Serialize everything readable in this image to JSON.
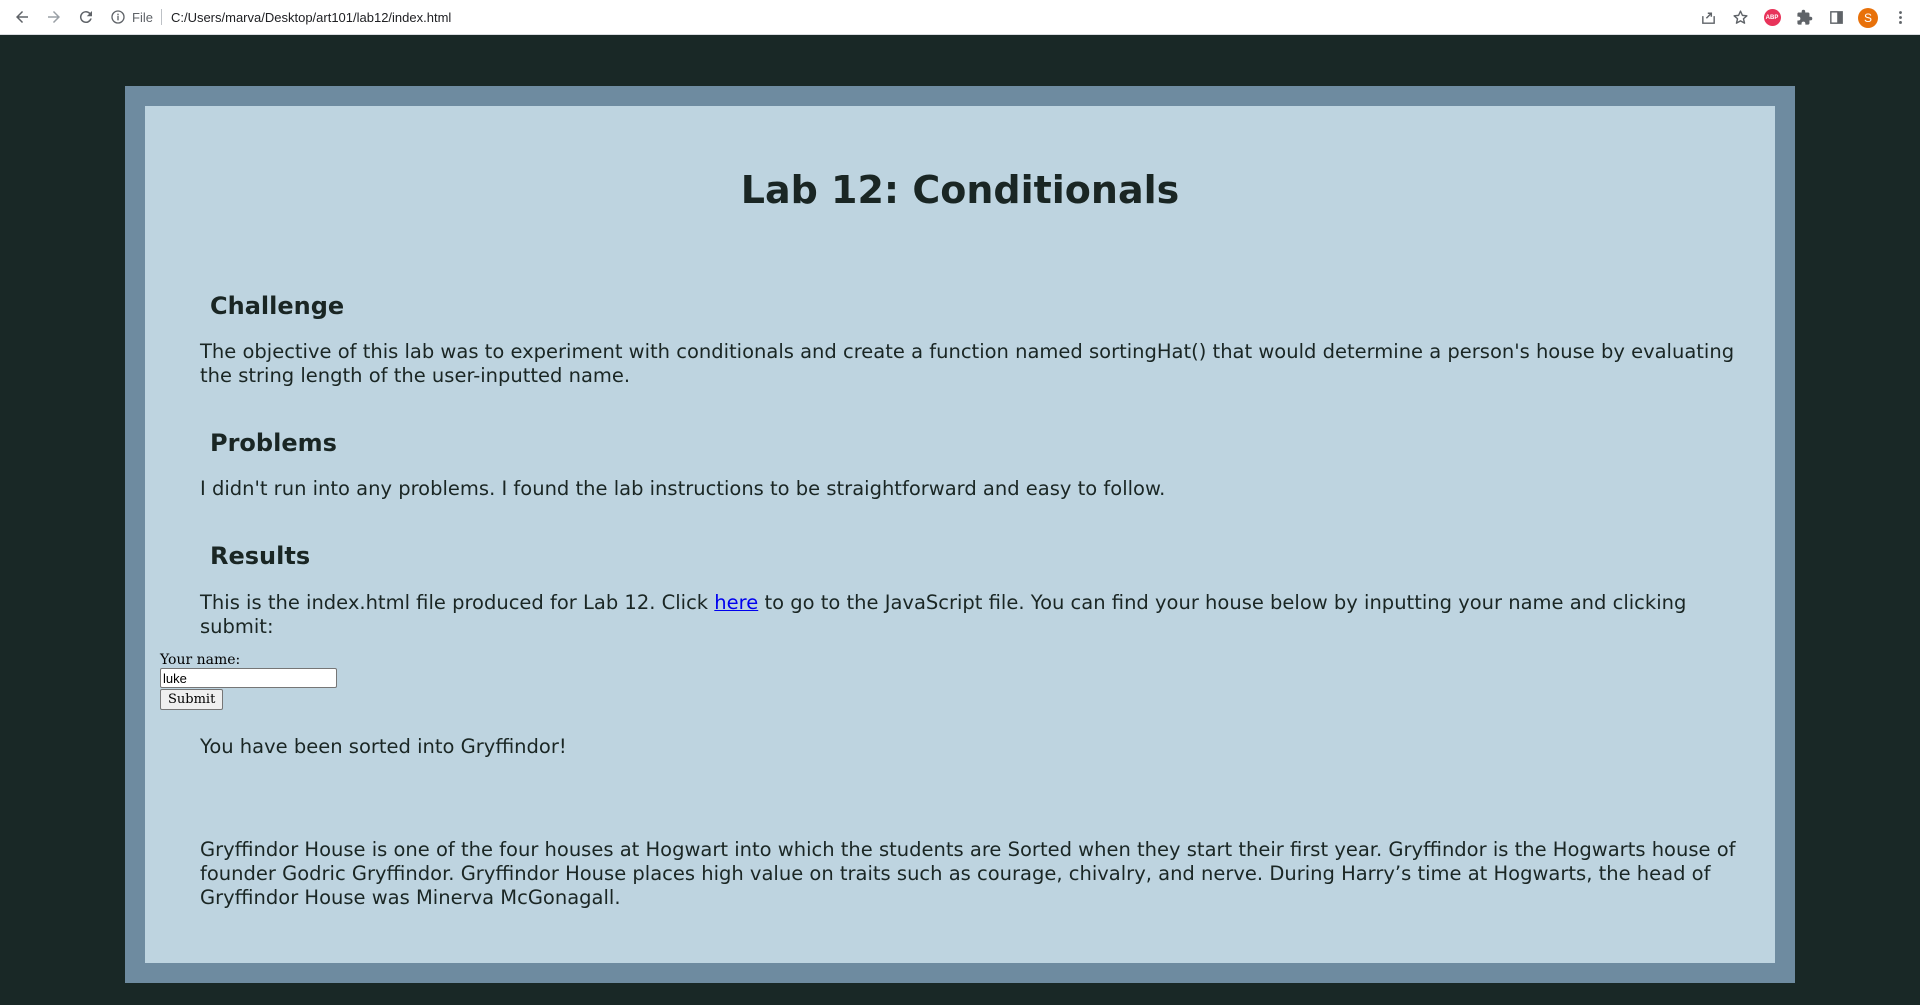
{
  "browser": {
    "scheme_label": "File",
    "url": "C:/Users/marva/Desktop/art101/lab12/index.html",
    "abp_label": "ABP",
    "avatar_letter": "S"
  },
  "page": {
    "title": "Lab 12: Conditionals",
    "sections": {
      "challenge": {
        "heading": "Challenge",
        "text": "The objective of this lab was to experiment with conditionals and create a function named sortingHat() that would determine a person's house by evaluating the string length of the user-inputted name."
      },
      "problems": {
        "heading": "Problems",
        "text": "I didn't run into any problems. I found the lab instructions to be straightforward and easy to follow."
      },
      "results": {
        "heading": "Results",
        "text_before_link": "This is the index.html file produced for Lab 12. Click ",
        "link_text": "here",
        "text_after_link": " to go to the JavaScript file. You can find your house below by inputting your name and clicking submit:"
      }
    },
    "form": {
      "label": "Your name:",
      "input_value": "luke",
      "submit_label": "Submit"
    },
    "output": "You have been sorted into Gryffindor!",
    "description": "Gryffindor House is one of the four houses at Hogwart into which the students are Sorted when they start their first year. Gryffindor is the Hogwarts house of founder Godric Gryffindor. Gryffindor House places high value on traits such as courage, chivalry, and nerve. During Harry’s time at Hogwarts, the head of Gryffindor House was Minerva McGonagall."
  },
  "colors": {
    "page_background": "#192826",
    "frame": "#6e8ba0",
    "content_background": "#bed4e0",
    "text": "#1a2624",
    "link": "#0000ee"
  }
}
